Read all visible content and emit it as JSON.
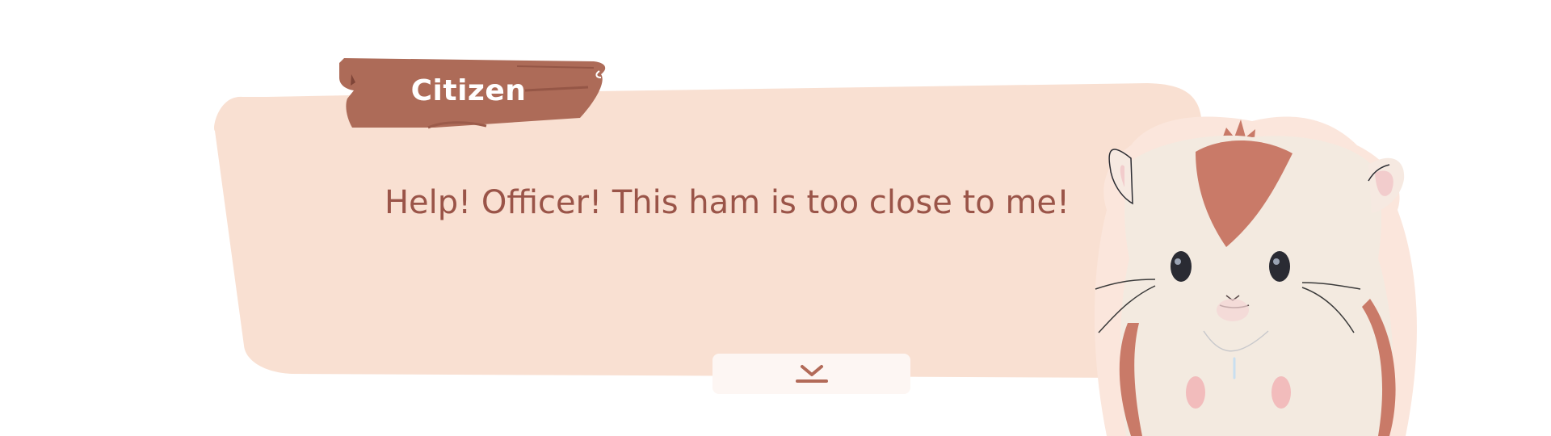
{
  "dialogue": {
    "speaker": "Citizen",
    "text": "Help! Officer! This ham is too close to me!"
  },
  "advance_button": {
    "icon": "chevron-down-bar-icon"
  },
  "character": {
    "icon": "hamster-portrait"
  },
  "colors": {
    "bubble": "#f9e0d2",
    "nameplate": "#ad6b58",
    "text": "#9a5448",
    "button": "#fdf6f3"
  }
}
